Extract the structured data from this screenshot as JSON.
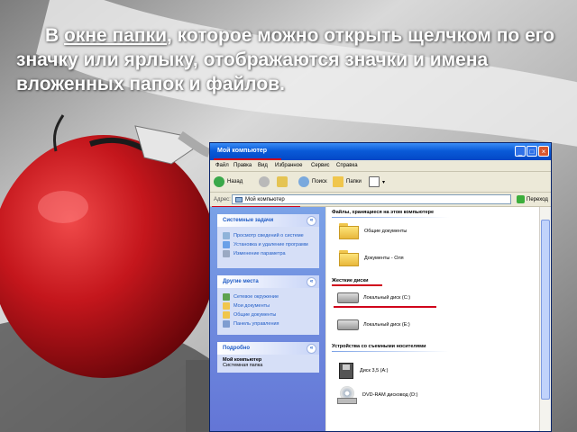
{
  "slide": {
    "text_part1": "В ",
    "text_link": "окне папки",
    "text_part2": ", которое можно открыть щелчком по его значку или ярлыку, отображаются значки и имена вложенных папок и файлов."
  },
  "window": {
    "title": "Мой компьютер",
    "menu": [
      "Файл",
      "Правка",
      "Вид",
      "Избранное",
      "Сервис",
      "Справка"
    ],
    "toolbar": {
      "back": "Назад",
      "search": "Поиск",
      "folders": "Папки"
    },
    "address": {
      "label": "Адрес:",
      "value": "Мой компьютер",
      "go": "Переход"
    }
  },
  "left_pane": {
    "system_tasks": {
      "title": "Системные задачи",
      "items": [
        "Просмотр сведений о системе",
        "Установка и удаление программ",
        "Изменение параметра"
      ]
    },
    "other_places": {
      "title": "Другие места",
      "items": [
        "Сетевое окружение",
        "Мои документы",
        "Общие документы",
        "Панель управления"
      ]
    },
    "details": {
      "title": "Подробно",
      "name": "Мой компьютер",
      "subtitle": "Системная папка"
    }
  },
  "content": {
    "section_files": "Файлы, хранящиеся на этом компьютере",
    "shared_docs": "Общие документы",
    "user_docs": "Документы - Оля",
    "section_drives": "Жесткие диски",
    "drive_c": "Локальный диск (C:)",
    "drive_e": "Локальный диск (E:)",
    "section_removable": "Устройства со съемными носителями",
    "floppy": "Диск 3,5 (A:)",
    "dvd": "DVD-RAM дисковод (D:)"
  },
  "colors": {
    "annotation_red": "#d0021b",
    "titlebar_blue": "#0a5bd8",
    "task_link": "#215dc6",
    "apple_red": "#c4161c"
  },
  "icons": [
    "folder-icon",
    "drive-icon",
    "floppy-icon",
    "dvd-icon",
    "back-icon",
    "forward-icon",
    "search-icon",
    "folders-icon",
    "views-icon",
    "go-icon",
    "my-computer-icon"
  ]
}
